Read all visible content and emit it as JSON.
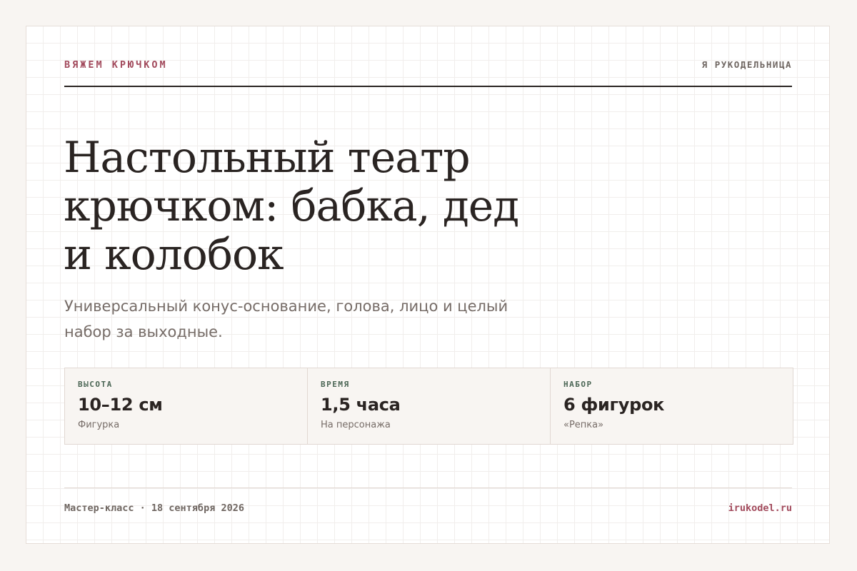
{
  "header": {
    "brand": "ВЯЖЕМ КРЮЧКОМ",
    "site_name": "Я РУКОДЕЛЬНИЦА"
  },
  "main": {
    "title": "Настольный театр крючком: бабка, дед и колобок",
    "subtitle": "Универсальный конус-основание, голова, лицо и целый набор за выходные."
  },
  "stats": [
    {
      "label": "ВЫСОТА",
      "value": "10–12 см",
      "caption": "Фигурка"
    },
    {
      "label": "ВРЕМЯ",
      "value": "1,5 часа",
      "caption": "На персонажа"
    },
    {
      "label": "НАБОР",
      "value": "6 фигурок",
      "caption": "«Репка»"
    }
  ],
  "footer": {
    "date": "Мастер-класс · 18 сентября 2026",
    "url": "irukodel.ru"
  },
  "colors": {
    "accent": "#a24a5c",
    "label_green": "#4b6655",
    "text_dark": "#2a2422",
    "text_muted": "#766c67",
    "page_background": "#f8f5f2"
  }
}
